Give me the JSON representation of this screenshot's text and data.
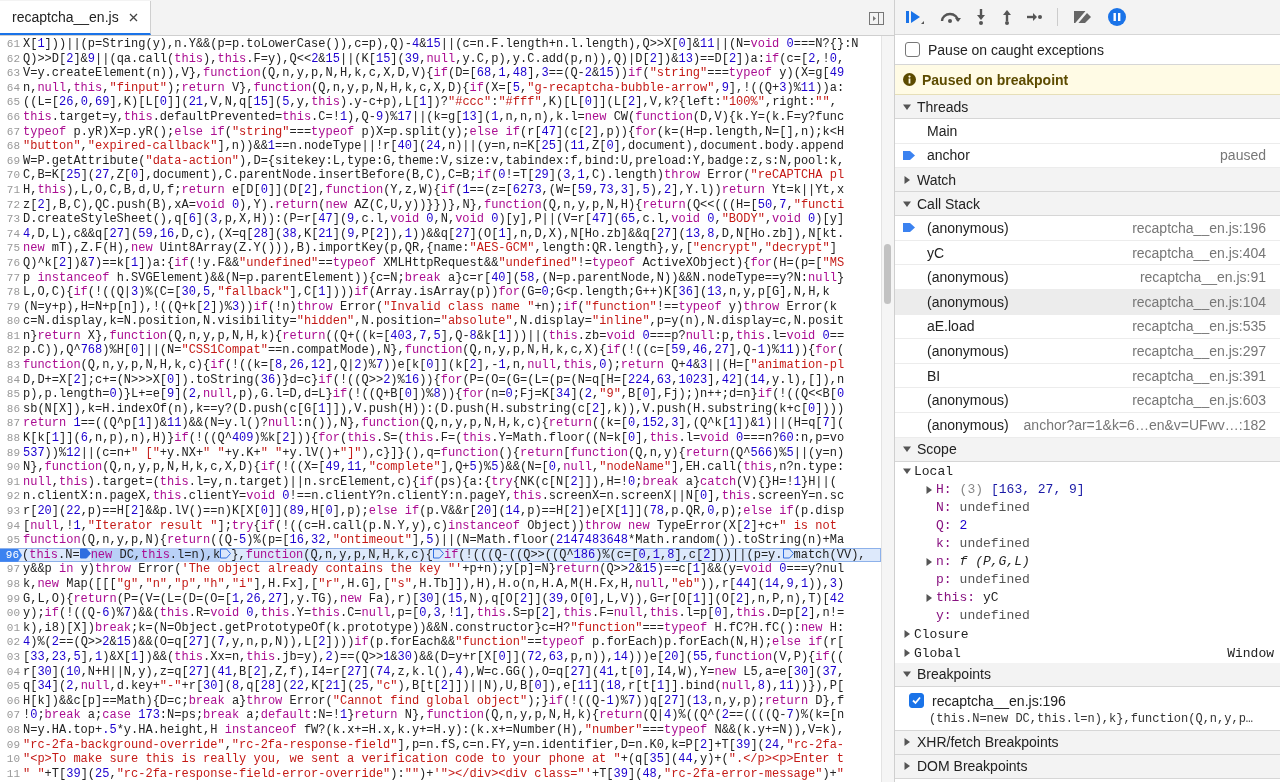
{
  "editor_tab": {
    "label": "recaptcha__en.js",
    "selected": true
  },
  "code": {
    "lines": [
      {
        "number": "61",
        "kind": "plain",
        "text": "X[1]))||(p=String(y),n.Y&&(p=p.toLowerCase()),c=p),Q)-4&15||(c=n.F.length+n.l.length),Q>>X[0]&11||(N=void 0===N?{}:N"
      },
      {
        "number": "62",
        "kind": "plain",
        "text": "Q)>>D[2]&9||(qa.call(this),this.F=y),Q<<2&15||(K[15](39,null,y.C,p),y.C.add(p,n)),Q)|D[2])&13)==D[2])a:if(c=[2,!0,"
      },
      {
        "number": "63",
        "kind": "plain",
        "text": "V=y.createElement(n)),V},function(Q,n,y,p,N,H,k,c,X,D,V){if(D=[68,1,48],3==(Q-2&15))if(\"string\"===typeof y)(X=g[49"
      },
      {
        "number": "64",
        "kind": "plain",
        "text": "n,null,this,\"finput\");return V},function(Q,n,y,p,N,H,k,c,X,D){if(X=[5,\"g-recaptcha-bubble-arrow\",9],!((Q+3)%11))a:"
      },
      {
        "number": "65",
        "kind": "plain",
        "text": "((L=[26,0,69],K)[L[0]](21,V,N,q[15](5,y,this).y-c+p),L[1])?\"#ccc\":\"#fff\",K)[L[0]](L[2],V,k?{left:\"100%\",right:\"\","
      },
      {
        "number": "66",
        "kind": "plain",
        "text": "this.target=y,this.defaultPrevented=this.C=!1),Q-9)%17||(k=g[13](1,n,n,n),k.l=new CW(function(D,V){k.Y=(k.F=y?func"
      },
      {
        "number": "67",
        "kind": "plain",
        "text": "typeof p.yR)X=p.yR();else if(\"string\"===typeof p)X=p.split(y);else if(r[47](c[2],p)){for(k=(H=p.length,N=[],n);k<H"
      },
      {
        "number": "68",
        "kind": "plain",
        "text": "\"button\",\"expired-callback\"],n))&&1==n.nodeType||!r[40](24,n)||(y=n,n=K[25](11,Z[0],document),document.body.append"
      },
      {
        "number": "69",
        "kind": "plain",
        "text": "W=P.getAttribute(\"data-action\"),D={sitekey:L,type:G,theme:V,size:v,tabindex:f,bind:U,preload:Y,badge:z,s:N,pool:k,"
      },
      {
        "number": "70",
        "kind": "plain",
        "text": "C,B=K[25](27,Z[0],document),C.parentNode.insertBefore(B,C),C=B;if(0!=T[29](3,1,C).length)throw Error(\"reCAPTCHA pl"
      },
      {
        "number": "71",
        "kind": "plain",
        "text": "H,this),L,O,C,B,d,U,f;return e[D[0]](D[2],function(Y,z,W){if(1==(z=[6273,(W=[59,73,3],5),2],Y.l))return Yt=k||Yt,x"
      },
      {
        "number": "72",
        "kind": "plain",
        "text": "z[2],B,C),QC.push(B),xA=void 0),Y).return(new AZ(C,U,y))}})},N},function(Q,n,y,p,N,H){return(Q<<(((H=[50,7,\"functi"
      },
      {
        "number": "73",
        "kind": "plain",
        "text": "D.createStyleSheet(),q[6](3,p,X,H)):(P=r[47](9,c.l,void 0,N,void 0)[y],P||(V=r[47](65,c.l,void 0,\"BODY\",void 0)[y]"
      },
      {
        "number": "74",
        "kind": "plain",
        "text": "4,D,L),c&&q[27](59,16,D,c),(X=q[28](38,K[21](9,P[2]),1))&&q[27](O[1],n,D,X),N[Ho.zb]&&q[27](13,8,D,N[Ho.zb]),N[kt."
      },
      {
        "number": "75",
        "kind": "plain",
        "text": "new mT),Z.F(H),new Uint8Array(Z.Y())),B).importKey(p,QR,{name:\"AES-GCM\",length:QR.length},y,[\"encrypt\",\"decrypt\"]"
      },
      {
        "number": "76",
        "kind": "plain",
        "text": "Q)^k[2])&7)==k[1])a:{if(!y.F&&\"undefined\"==typeof XMLHttpRequest&&\"undefined\"!=typeof ActiveXObject){for(H=(p=[\"MS"
      },
      {
        "number": "77",
        "kind": "plain",
        "text": "p instanceof h.SVGElement)&&(N=p.parentElement)){c=N;break a}c=r[40](58,(N=p.parentNode,N))&&N.nodeType==y?N:null}"
      },
      {
        "number": "78",
        "kind": "plain",
        "text": "L,O,C){if(!((Q|3)%(C=[30,5,\"fallback\"],C[1])))if(Array.isArray(p))for(G=0;G<p.length;G++)K[36](13,n,y,p[G],N,H,k"
      },
      {
        "number": "79",
        "kind": "plain",
        "text": "(N=y+p),H=N+p[n]),!((Q+k[2])%3))if(!n)throw Error(\"Invalid class name \"+n);if(\"function\"!==typeof y)throw Error(k"
      },
      {
        "number": "80",
        "kind": "plain",
        "text": "c=N.display,k=N.position,N.visibility=\"hidden\",N.position=\"absolute\",N.display=\"inline\",p=y(n),N.display=c,N.posit"
      },
      {
        "number": "81",
        "kind": "plain",
        "text": "n}return X},function(Q,n,y,p,N,H,k){return((Q+((k=[403,7,5],Q-8&k[1]))||(this.zb=void 0===p?null:p,this.l=void 0=="
      },
      {
        "number": "82",
        "kind": "plain",
        "text": "p.C)),Q^768)%H[0]||(N=\"CSS1Compat\"==n.compatMode),N},function(Q,n,y,p,N,H,k,c,X){if(!((c=[59,46,27],Q-1)%11)){for("
      },
      {
        "number": "83",
        "kind": "plain",
        "text": "function(Q,n,y,p,N,H,k,c){if(!((k=[8,26,12],Q|2)%7))e[k[0]](k[2],-1,n,null,this,0);return Q+4&3||(H=[\"animation-pl"
      },
      {
        "number": "84",
        "kind": "plain",
        "text": "D,D+=X[2];c+=(N>>>X[0]).toString(36)}d=c}if(!((Q>>2)%16)){for(P=(O=(G=(L=(p=(N=q[H=[224,63,1023],42](14,y.l),[]),n"
      },
      {
        "number": "85",
        "kind": "plain",
        "text": "p),p.length=0)}L+=e[9](2,null,p),G.l=D,d=L}if(!((Q+B[0])%8)){for(n=0;Fj=K[34](2,\"9\",B[0],Fj);)n++;d=n}if(!((Q<<B[0"
      },
      {
        "number": "86",
        "kind": "plain",
        "text": "sb(N[X]),k=H.indexOf(n),k==y?(D.push(c[G[1]]),V.push(H)):(D.push(H.substring(c[2],k)),V.push(H.substring(k+c[0])))"
      },
      {
        "number": "87",
        "kind": "plain",
        "text": "return 1==((Q^p[1])&11)&&(N=y.l()?null:n()),N},function(Q,n,y,p,N,H,k,c){return((k=[0,152,3],(Q^k[1])&1)||(H=q[7]("
      },
      {
        "number": "88",
        "kind": "plain",
        "text": "K[k[1]](6,n,p),n),H)}if(!((Q^409)%k[2])){for(this.S=(this.F=(this.Y=Math.floor((N=k[0],this.l=void 0===n?60:n,p=vo"
      },
      {
        "number": "89",
        "kind": "plain",
        "text": "537))%12||(c=n+\" [\"+y.NX+\" \"+y.K+\" \"+y.lV()+\"]\"),c}]}(),q=function(){return[function(Q,n,y){return(Q^566)%5||(y=n)"
      },
      {
        "number": "90",
        "kind": "plain",
        "text": "N},function(Q,n,y,p,N,H,k,c,X,D){if(!((X=[49,11,\"complete\"],Q+5)%5)&&(N=[0,null,\"nodeName\"],EH.call(this,n?n.type:"
      },
      {
        "number": "91",
        "kind": "plain",
        "text": "null,this).target=(this.l=y,n.target)||n.srcElement,c){if(ps){a:{try{NK(c[N[2]]),H=!0;break a}catch(V){}H=!1}H||("
      },
      {
        "number": "92",
        "kind": "plain",
        "text": "n.clientX:n.pageX,this.clientY=void 0!==n.clientY?n.clientY:n.pageY,this.screenX=n.screenX||N[0],this.screenY=n.sc"
      },
      {
        "number": "93",
        "kind": "plain",
        "text": "r[20](22,p)==H[2]&&p.lV()==n)K[X[0]](89,H[0],p);else if(p.V&&r[20](14,p)==H[2])e[X[1]](78,p.QR,0,p);else if(p.disp"
      },
      {
        "number": "94",
        "kind": "plain",
        "text": "[null,!1,\"Iterator result \"];try{if(!((c=H.call(p.N.Y,y),c)instanceof Object))throw new TypeError(X[2]+c+\" is not"
      },
      {
        "number": "95",
        "kind": "plain",
        "text": "function(Q,n,y,p,N){return((Q-5)%(p=[16,32,\"ontimeout\"],5)||(N=Math.floor(2147483648*Math.random()).toString(n)+Ma"
      },
      {
        "number": "96",
        "kind": "paused",
        "pieces": [
          {
            "text": "(this.N=",
            "current": false
          },
          {
            "text": "new DC,this.l=n),k",
            "current": true
          },
          {
            "text": "},function(Q,n,y,p,N,H,k,c){",
            "current": false
          },
          {
            "text": "if(!(((Q-((Q>>((Q^186)%(c=[0,1,8],c[2]))||(p=y.",
            "current": false
          },
          {
            "text": "match(VV),",
            "current": false
          }
        ]
      },
      {
        "number": "97",
        "kind": "plain",
        "text": "y&&p in y)throw Error('The object already contains the key \"'+p+n);y[p]=N}return(Q>>2&15)==c[1]&&(y=void 0===y?nul"
      },
      {
        "number": "98",
        "kind": "plain",
        "text": "k,new Map([[[\"g\",\"n\",\"p\",\"h\",\"i\"],H.Fx],[\"r\",H.G],[\"s\",H.Tb]]),H),H.o(n,H.A,M(H.Fx,H,null,\"eb\")),r[44](14,9,1)),3)"
      },
      {
        "number": "99",
        "kind": "plain",
        "text": "G,L,O){return(P=(V=(L=(D=(O=[1,26,27],y.TG),new Fa),r)[30](15,N),q[O[2]](39,O[0],L,V)),G=r[O[1]](O[2],n,P,n),T)[42"
      },
      {
        "number": "00",
        "kind": "plain",
        "text": "y);if(!((Q-6)%7)&&(this.R=void 0,this.Y=this.C=null,p=[0,3,!1],this.S=p[2],this.F=null,this.l=p[0],this.D=p[2],n!="
      },
      {
        "number": "01",
        "kind": "plain",
        "text": "k),i8)[X])break;k=(N=Object.getPrototypeOf(k.prototype))&&N.constructor}c=H?\"function\"===typeof H.fC?H.fC():new H:"
      },
      {
        "number": "02",
        "kind": "plain",
        "text": "4)%(2==(Q>>2&15)&&(O=q[27](7,y,n,p,N)),L[2])))if(p.forEach&&\"function\"==typeof p.forEach)p.forEach(N,H);else if(r["
      },
      {
        "number": "03",
        "kind": "plain",
        "text": "[33,23,5],1)&X[1])&&(this.Xx=n,this.jb=y),2)==(Q>>1&30)&&(D=y+r[X[0]](72,63,p,n)),14)))e[20](55,function(V,P){if(("
      },
      {
        "number": "04",
        "kind": "plain",
        "text": "r[30](10,N+H||N,y),z=q[27](41,B[2],Z,f),I4=r[27](74,z,k.l(),4),W=c.GG(),O=q[27](41,t[0],I4,W),Y=new L5,a=e[30](37,"
      },
      {
        "number": "05",
        "kind": "plain",
        "text": "q[34](2,null,d.key+\"-\"+r[30](8,q[28](22,K[21](25,\"c\"),B[t[2]])||N),U,B[0]),e[11](18,r[t[1]].bind(null,8),11))}),P["
      },
      {
        "number": "06",
        "kind": "plain",
        "text": "H[k])&&c[p]==Math){D=c;break a}throw Error(\"Cannot find global object\");}if(!((Q-1)%7))q[27](13,n,y,p);return D},f"
      },
      {
        "number": "07",
        "kind": "plain",
        "text": "!0;break a;case 173:N=ps;break a;default:N=!1}return N},function(Q,n,y,p,N,H,k){return(Q|4)%((Q^(2==((((Q-7)%(k=[n"
      },
      {
        "number": "08",
        "kind": "plain",
        "text": "N=y.HA.top+.5*y.HA.height,H instanceof fW?(k.x+=H.x,k.y+=H.y):(k.x+=Number(H),\"number\"===typeof N&&(k.y+=N)),V=k),"
      },
      {
        "number": "09",
        "kind": "plain",
        "text": "\"rc-2fa-background-override\",\"rc-2fa-response-field\"],p=n.fS,c=n.FY,y=n.identifier,D=n.K0,k=P[2]+T[39](24,\"rc-2fa-"
      },
      {
        "number": "10",
        "kind": "plain",
        "text": "\"<p>To make sure this is really you, we sent a verification code to your phone at \"+(q[35](44,y)+(\".</p><p>Enter t"
      },
      {
        "number": "11",
        "kind": "plain",
        "text": "\" \"+T[39](25,\"rc-2fa-response-field-error-override\"):\"\")+'\"></div><div class=\"'+T[39](48,\"rc-2fa-error-message\")+\""
      }
    ]
  },
  "pause_on_caught_exceptions": {
    "label": "Pause on caught exceptions",
    "checked": false
  },
  "banner": {
    "text": "Paused on breakpoint"
  },
  "threads": {
    "title": "Threads",
    "expanded": true,
    "items": [
      {
        "name": "Main",
        "selected": false
      },
      {
        "name": "anchor",
        "status": "paused",
        "selected": true
      }
    ]
  },
  "watch": {
    "title": "Watch",
    "expanded": false
  },
  "call_stack": {
    "title": "Call Stack",
    "expanded": true,
    "frames": [
      {
        "name": "(anonymous)",
        "location": "recaptcha__en.js:196",
        "selected": true,
        "hovered": false
      },
      {
        "name": "yC",
        "location": "recaptcha__en.js:404",
        "selected": false,
        "hovered": false
      },
      {
        "name": "(anonymous)",
        "location": "recaptcha__en.js:91",
        "selected": false,
        "hovered": false
      },
      {
        "name": "(anonymous)",
        "location": "recaptcha__en.js:104",
        "selected": false,
        "hovered": true
      },
      {
        "name": "aE.load",
        "location": "recaptcha__en.js:535",
        "selected": false,
        "hovered": false
      },
      {
        "name": "(anonymous)",
        "location": "recaptcha__en.js:297",
        "selected": false,
        "hovered": false
      },
      {
        "name": "BI",
        "location": "recaptcha__en.js:391",
        "selected": false,
        "hovered": false
      },
      {
        "name": "(anonymous)",
        "location": "recaptcha__en.js:603",
        "selected": false,
        "hovered": false
      },
      {
        "name": "(anonymous)",
        "location": "anchor?ar=1&k=6…en&v=UFwv…:182",
        "selected": false,
        "hovered": false
      }
    ]
  },
  "scope": {
    "title": "Scope",
    "expanded": true,
    "groups": [
      {
        "name": "Local",
        "expanded": true,
        "variables": [
          {
            "name": "H:",
            "kind": "array",
            "count": "(3)",
            "value": "[163, 27, 9]",
            "expandable": true
          },
          {
            "name": "N:",
            "kind": "undefined",
            "value": "undefined",
            "expandable": false
          },
          {
            "name": "Q:",
            "kind": "number",
            "value": "2",
            "expandable": false
          },
          {
            "name": "k:",
            "kind": "undefined",
            "value": "undefined",
            "expandable": false
          },
          {
            "name": "n:",
            "kind": "function",
            "value": "f (P,G,L)",
            "expandable": true
          },
          {
            "name": "p:",
            "kind": "undefined",
            "value": "undefined",
            "expandable": false
          },
          {
            "name": "this:",
            "kind": "object",
            "value": "yC",
            "expandable": true
          },
          {
            "name": "y:",
            "kind": "undefined",
            "value": "undefined",
            "expandable": false
          }
        ]
      },
      {
        "name": "Closure",
        "expanded": false
      },
      {
        "name": "Global",
        "expanded": false,
        "value": "Window"
      }
    ]
  },
  "breakpoints": {
    "title": "Breakpoints",
    "expanded": true,
    "items": [
      {
        "location": "recaptcha__en.js:196",
        "snippet": "(this.N=new DC,this.l=n),k},function(Q,n,y,p…",
        "checked": true
      }
    ]
  },
  "xhr_fetch_breakpoints": {
    "title": "XHR/fetch Breakpoints",
    "expanded": false
  },
  "dom_breakpoints": {
    "title": "DOM Breakpoints",
    "expanded": false
  }
}
